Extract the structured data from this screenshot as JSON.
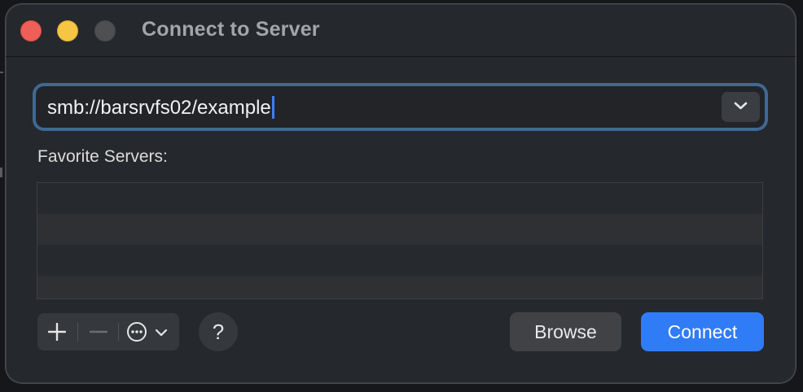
{
  "window": {
    "title": "Connect to Server"
  },
  "address": {
    "value": "smb://barsrvfs02/example"
  },
  "favorites": {
    "label": "Favorite Servers:",
    "rows": [
      "",
      "",
      "",
      ""
    ]
  },
  "toolbar": {
    "add_icon": "plus-icon",
    "remove_icon": "minus-icon",
    "actions_icon": "ellipsis-circle-icon",
    "help_label": "?"
  },
  "buttons": {
    "browse": "Browse",
    "connect": "Connect"
  },
  "colors": {
    "accent": "#2f7cf6",
    "focus_ring": "#3f6994",
    "window_bg": "#25282c"
  }
}
